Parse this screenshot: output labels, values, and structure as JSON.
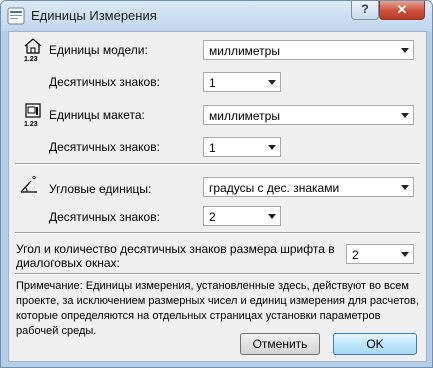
{
  "window": {
    "title": "Единицы Измерения",
    "help_label": "?",
    "close_label": "✕"
  },
  "model_units": {
    "icon": "house-units-icon",
    "icon_caption": "1.23",
    "label": "Единицы модели:",
    "value": "миллиметры",
    "decimals_label": "Десятичных знаков:",
    "decimals_value": "1"
  },
  "layout_units": {
    "icon": "layout-units-icon",
    "icon_caption": "1.23",
    "label": "Единицы макета:",
    "value": "миллиметры",
    "decimals_label": "Десятичных знаков:",
    "decimals_value": "1"
  },
  "angle_units": {
    "icon": "angle-units-icon",
    "icon_caption": "°",
    "label": "Угловые единицы:",
    "value": "градусы с дес. знаками",
    "decimals_label": "Десятичных знаков:",
    "decimals_value": "2"
  },
  "font_size": {
    "label_line1": "Угол и количество десятичных знаков размера шрифта в",
    "label_line2": "диалоговых окнах:",
    "value": "2"
  },
  "note": "Примечание: Единицы измерения, установленные здесь, действуют во всем проекте, за исключением размерных чисел и единиц измерения для расчетов, которые определяются на отдельных страницах установки параметров рабочей среды.",
  "buttons": {
    "cancel": "Отменить",
    "ok": "OK"
  }
}
